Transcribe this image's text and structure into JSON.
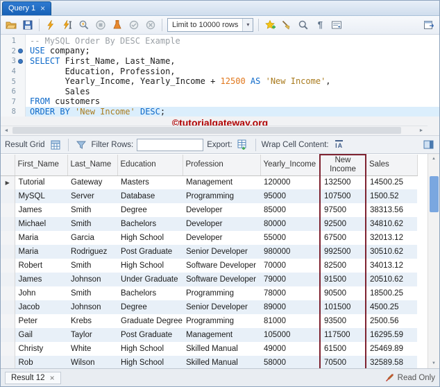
{
  "tab_bar": {
    "tab_label": "Query 1",
    "close_glyph": "×"
  },
  "toolbar": {
    "limit_label": "Limit to 10000 rows",
    "dropdown_arrow": "▾",
    "pilcrow_glyph": "¶"
  },
  "editor": {
    "lines": [
      {
        "num": "1",
        "dot": false,
        "current": false,
        "tokens": [
          {
            "t": "com",
            "v": "-- MySQL Order By DESC Example"
          }
        ]
      },
      {
        "num": "2",
        "dot": true,
        "current": false,
        "tokens": [
          {
            "t": "kw",
            "v": "USE"
          },
          {
            "t": "pl",
            "v": " company;"
          }
        ]
      },
      {
        "num": "3",
        "dot": true,
        "current": false,
        "tokens": [
          {
            "t": "kw",
            "v": "SELECT"
          },
          {
            "t": "pl",
            "v": " First_Name, Last_Name,"
          }
        ]
      },
      {
        "num": "4",
        "dot": false,
        "current": false,
        "tokens": [
          {
            "t": "pl",
            "v": "       Education, Profession,"
          }
        ]
      },
      {
        "num": "5",
        "dot": false,
        "current": false,
        "tokens": [
          {
            "t": "pl",
            "v": "       Yearly_Income, Yearly_Income + "
          },
          {
            "t": "num",
            "v": "12500"
          },
          {
            "t": "pl",
            "v": " "
          },
          {
            "t": "kw",
            "v": "AS"
          },
          {
            "t": "pl",
            "v": " "
          },
          {
            "t": "str",
            "v": "'New Income'"
          },
          {
            "t": "pl",
            "v": ","
          }
        ]
      },
      {
        "num": "6",
        "dot": false,
        "current": false,
        "tokens": [
          {
            "t": "pl",
            "v": "       Sales"
          }
        ]
      },
      {
        "num": "7",
        "dot": false,
        "current": false,
        "tokens": [
          {
            "t": "kw",
            "v": "FROM"
          },
          {
            "t": "pl",
            "v": " customers"
          }
        ]
      },
      {
        "num": "8",
        "dot": false,
        "current": true,
        "tokens": [
          {
            "t": "kw",
            "v": "ORDER BY"
          },
          {
            "t": "pl",
            "v": " "
          },
          {
            "t": "str",
            "v": "'New Income'"
          },
          {
            "t": "pl",
            "v": " "
          },
          {
            "t": "kw",
            "v": "DESC"
          },
          {
            "t": "pl",
            "v": ";"
          }
        ]
      }
    ]
  },
  "watermark": "©tutorialgateway.org",
  "scroll": {
    "left_arrow": "◄",
    "right_arrow": "►",
    "up_arrow": "▲",
    "down_arrow": "▼"
  },
  "result_toolbar": {
    "grid_label": "Result Grid",
    "filter_label": "Filter Rows:",
    "filter_value": "",
    "export_label": "Export:",
    "wrap_label": "Wrap Cell Content:",
    "wrap_icon_text": "IA"
  },
  "result_grid": {
    "columns": [
      "First_Name",
      "Last_Name",
      "Education",
      "Profession",
      "Yearly_Income",
      "New Income",
      "Sales"
    ],
    "highlight_column": "New Income",
    "highlight_column_index": 5,
    "row_marker": "▶",
    "rows": [
      [
        "Tutorial",
        "Gateway",
        "Masters",
        "Management",
        "120000",
        "132500",
        "14500.25"
      ],
      [
        "MySQL",
        "Server",
        "Database",
        "Programming",
        "95000",
        "107500",
        "1500.52"
      ],
      [
        "James",
        "Smith",
        "Degree",
        "Developer",
        "85000",
        "97500",
        "38313.56"
      ],
      [
        "Michael",
        "Smith",
        "Bachelors",
        "Developer",
        "80000",
        "92500",
        "34810.62"
      ],
      [
        "Maria",
        "Garcia",
        "High School",
        "Developer",
        "55000",
        "67500",
        "32013.12"
      ],
      [
        "Maria",
        "Rodriguez",
        "Post Graduate",
        "Senior Developer",
        "980000",
        "992500",
        "30510.62"
      ],
      [
        "Robert",
        "Smith",
        "High School",
        "Software Developer",
        "70000",
        "82500",
        "34013.12"
      ],
      [
        "James",
        "Johnson",
        "Under Graduate",
        "Software Developer",
        "79000",
        "91500",
        "20510.62"
      ],
      [
        "John",
        "Smith",
        "Bachelors",
        "Programming",
        "78000",
        "90500",
        "18500.25"
      ],
      [
        "Jacob",
        "Johnson",
        "Degree",
        "Senior Developer",
        "89000",
        "101500",
        "4500.25"
      ],
      [
        "Peter",
        "Krebs",
        "Graduate Degree",
        "Programming",
        "81000",
        "93500",
        "2500.56"
      ],
      [
        "Gail",
        "Taylor",
        "Post Graduate",
        "Management",
        "105000",
        "117500",
        "16295.59"
      ],
      [
        "Christy",
        "White",
        "High School",
        "Skilled Manual",
        "49000",
        "61500",
        "25469.89"
      ],
      [
        "Rob",
        "Wilson",
        "High School",
        "Skilled Manual",
        "58000",
        "70500",
        "32589.58"
      ]
    ]
  },
  "status_bar": {
    "result_tab": "Result 12",
    "close_glyph": "×",
    "read_only": "Read Only"
  },
  "colors": {
    "tab_blue": "#1761b6",
    "keyword": "#0d69c9",
    "string": "#a97b1e",
    "number": "#e0761a",
    "comment": "#9aa0a6",
    "watermark_red": "#b00000",
    "highlight_box": "#7e2230",
    "row_alt": "#e8f0f8"
  }
}
